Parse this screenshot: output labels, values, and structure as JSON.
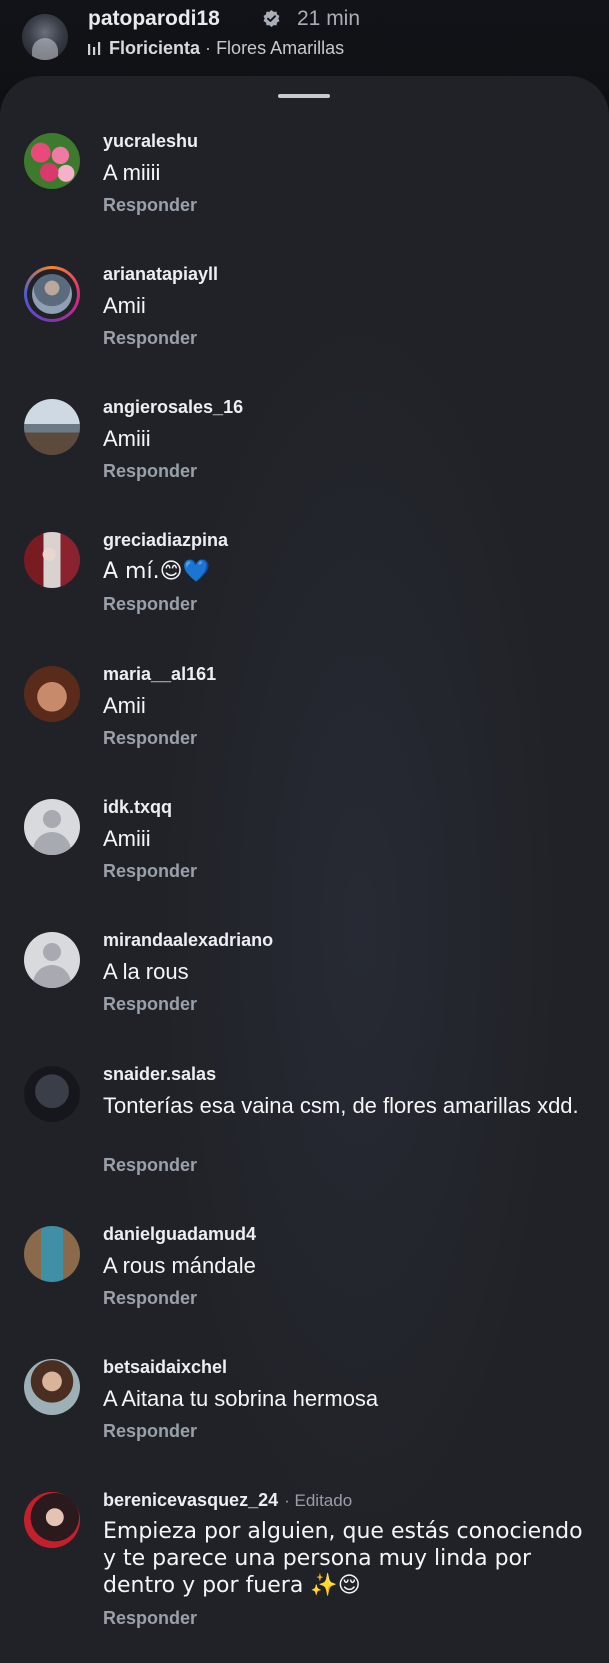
{
  "post": {
    "username": "patoparodi18",
    "time": "21 min",
    "song": "Floricienta",
    "separator": "·",
    "artist": "Flores Amarillas"
  },
  "comments": [
    {
      "username": "yucraleshu",
      "text": "A miiii",
      "reply": "Responder",
      "avatar": "flowers-avatar"
    },
    {
      "username": "arianatapiayll",
      "text": "Amii",
      "reply": "Responder",
      "avatar": "story-ring-avatar"
    },
    {
      "username": "angierosales_16",
      "text": "Amiii",
      "reply": "Responder",
      "avatar": "landscape-avatar"
    },
    {
      "username": "greciadiazpina",
      "text": "A mí.😊💙",
      "reply": "Responder",
      "avatar": "photo-avatar"
    },
    {
      "username": "maria__al161",
      "text": "Amii",
      "reply": "Responder",
      "avatar": "hand-avatar"
    },
    {
      "username": "idk.txqq",
      "text": "Amiii",
      "reply": "Responder",
      "avatar": "default-avatar"
    },
    {
      "username": "mirandaalexadriano",
      "text": "A la rous",
      "reply": "Responder",
      "avatar": "default-avatar"
    },
    {
      "username": "snaider.salas",
      "text": "Tonterías esa vaina csm, de flores amarillas xdd.",
      "reply": "Responder",
      "avatar": "dark-avatar"
    },
    {
      "username": "danielguadamud4",
      "text": "A rous mándale",
      "reply": "Responder",
      "avatar": "shop-avatar"
    },
    {
      "username": "betsaidaixchel",
      "text": "A Aitana tu sobrina hermosa",
      "reply": "Responder",
      "avatar": "woman-avatar"
    },
    {
      "username": "berenicevasquez_24",
      "edited": "· Editado",
      "text": "Empieza por alguien, que estás conociendo y te parece una persona muy linda por dentro y por fuera ✨😌",
      "reply": "Responder",
      "avatar": "woman-avatar"
    }
  ]
}
